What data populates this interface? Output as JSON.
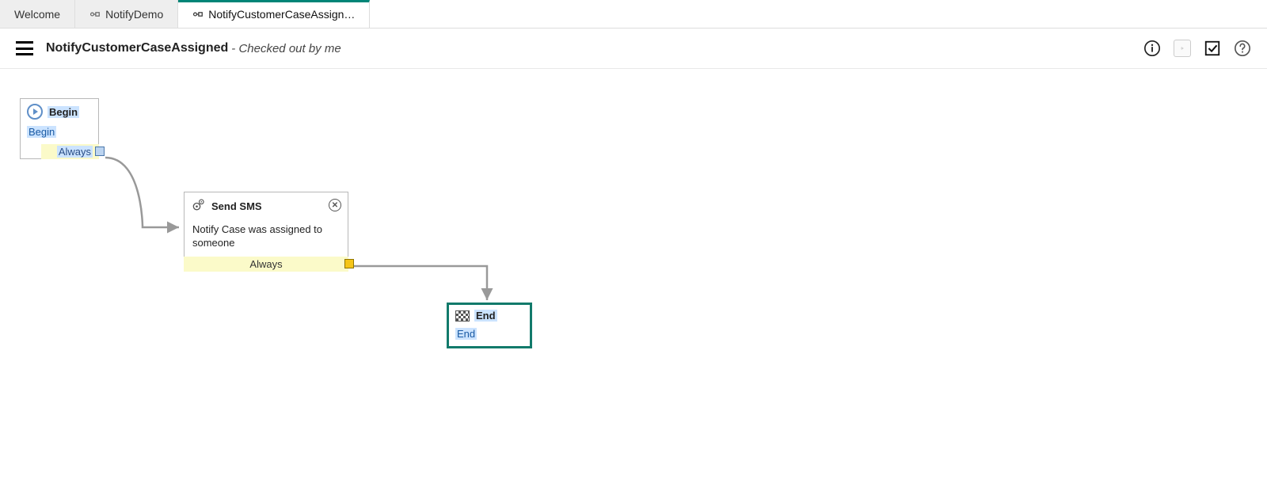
{
  "tabs": [
    {
      "label": "Welcome",
      "has_icon": false
    },
    {
      "label": "NotifyDemo",
      "has_icon": true
    },
    {
      "label": "NotifyCustomerCaseAssign…",
      "has_icon": true
    }
  ],
  "header": {
    "title": "NotifyCustomerCaseAssigned",
    "status": "- Checked out by me"
  },
  "nodes": {
    "begin": {
      "title": "Begin",
      "sub": "Begin",
      "transition": "Always"
    },
    "send": {
      "title": "Send SMS",
      "desc": "Notify Case was assigned to someone",
      "transition": "Always"
    },
    "end": {
      "title": "End",
      "sub": "End"
    }
  }
}
